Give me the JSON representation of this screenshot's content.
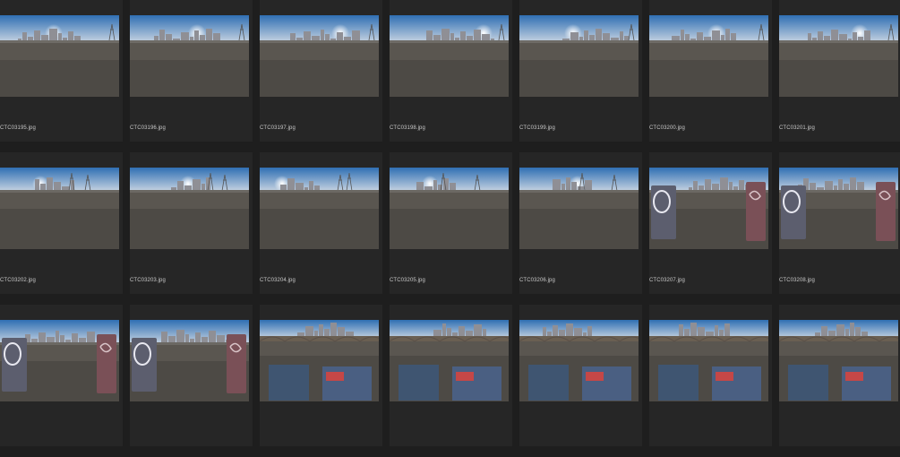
{
  "browser": {
    "rows": [
      [
        {
          "name": "CTC03195.jpg",
          "variant": "skyline"
        },
        {
          "name": "CTC03196.jpg",
          "variant": "skyline"
        },
        {
          "name": "CTC03197.jpg",
          "variant": "skyline"
        },
        {
          "name": "CTC03198.jpg",
          "variant": "skyline"
        },
        {
          "name": "CTC03199.jpg",
          "variant": "skyline"
        },
        {
          "name": "CTC03200.jpg",
          "variant": "skyline"
        },
        {
          "name": "CTC03201.jpg",
          "variant": "skyline"
        }
      ],
      [
        {
          "name": "CTC03202.jpg",
          "variant": "towers"
        },
        {
          "name": "CTC03203.jpg",
          "variant": "towers"
        },
        {
          "name": "CTC03204.jpg",
          "variant": "towers"
        },
        {
          "name": "CTC03205.jpg",
          "variant": "towers"
        },
        {
          "name": "CTC03206.jpg",
          "variant": "towers"
        },
        {
          "name": "CTC03207.jpg",
          "variant": "graffiti"
        },
        {
          "name": "CTC03208.jpg",
          "variant": "graffiti"
        }
      ],
      [
        {
          "name": "",
          "variant": "graffiti"
        },
        {
          "name": "",
          "variant": "graffiti"
        },
        {
          "name": "",
          "variant": "bridge"
        },
        {
          "name": "",
          "variant": "bridge"
        },
        {
          "name": "",
          "variant": "bridge"
        },
        {
          "name": "",
          "variant": "bridge"
        },
        {
          "name": "",
          "variant": "bridge"
        }
      ]
    ]
  }
}
